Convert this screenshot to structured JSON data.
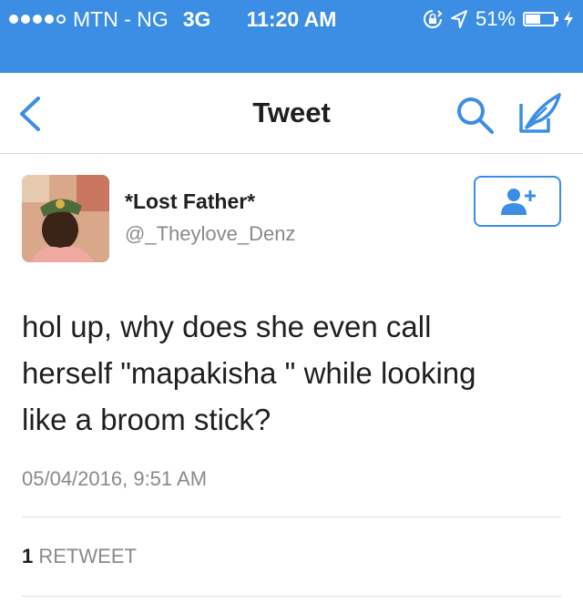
{
  "status_bar": {
    "carrier": "MTN - NG",
    "network": "3G",
    "time": "11:20 AM",
    "battery_percent": "51%",
    "battery_level": 0.51,
    "signal_bars_filled": 4,
    "signal_bars_total": 5,
    "icons": [
      "orientation-lock-icon",
      "location-arrow-icon",
      "battery-icon",
      "charging-bolt-icon"
    ]
  },
  "nav": {
    "title": "Tweet",
    "icons": [
      "back-chevron-icon",
      "search-icon",
      "compose-quill-icon"
    ]
  },
  "tweet": {
    "display_name": "*Lost Father*",
    "handle": "@_Theylove_Denz",
    "text_lines": [
      "hol up, why does she even call",
      "herself \"mapakisha \" while looking",
      "like a broom stick?"
    ],
    "timestamp": "05/04/2016, 9:51 AM",
    "retweet_count": "1",
    "retweet_label": "RETWEET",
    "follow_icon": "add-person-icon"
  },
  "colors": {
    "accent": "#3b8ee3",
    "text": "#1f1f1f",
    "secondary_text": "#8a8a8a",
    "divider": "#dedede"
  }
}
